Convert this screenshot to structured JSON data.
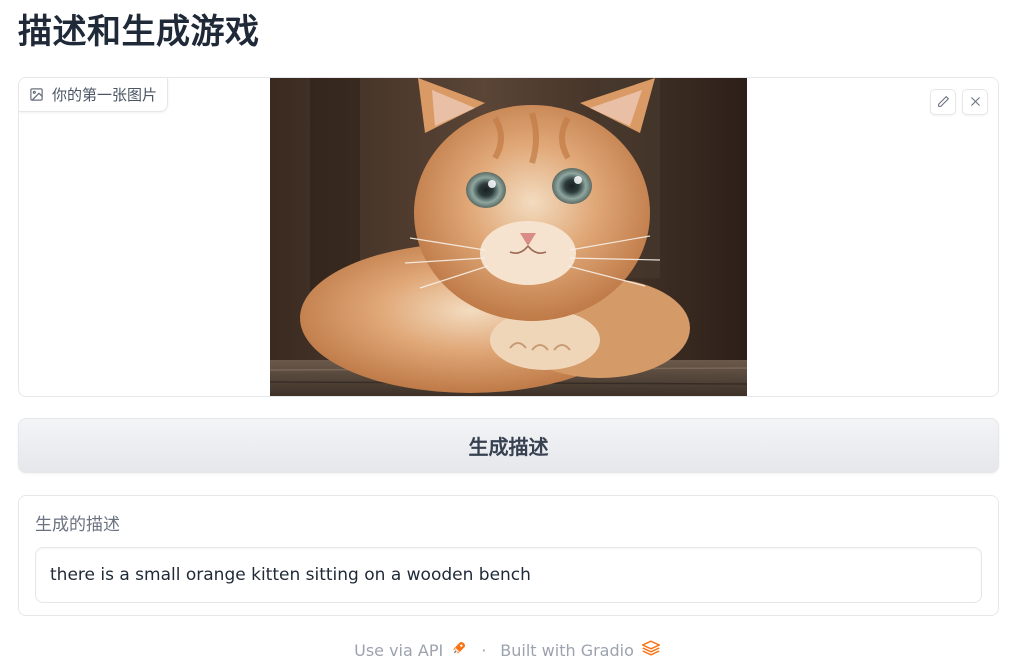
{
  "page": {
    "title": "描述和生成游戏"
  },
  "image_input": {
    "label": "你的第一张图片",
    "label_icon": "image-icon",
    "image_description_icon": "kitten-photo",
    "tools": [
      {
        "name": "edit",
        "icon": "pencil-icon"
      },
      {
        "name": "clear",
        "icon": "close-icon"
      }
    ]
  },
  "generate_button": {
    "label": "生成描述"
  },
  "output": {
    "label": "生成的描述",
    "value": "there is a small orange kitten sitting on a wooden bench"
  },
  "footer": {
    "api_link": "Use via API",
    "api_icon": "rocket-icon",
    "separator": "·",
    "built_with": "Built with Gradio",
    "gradio_icon": "gradio-logo-icon"
  },
  "colors": {
    "accent_orange": "#f97316",
    "border": "#e5e7eb",
    "text": "#1f2937",
    "muted": "#9ca3af"
  }
}
